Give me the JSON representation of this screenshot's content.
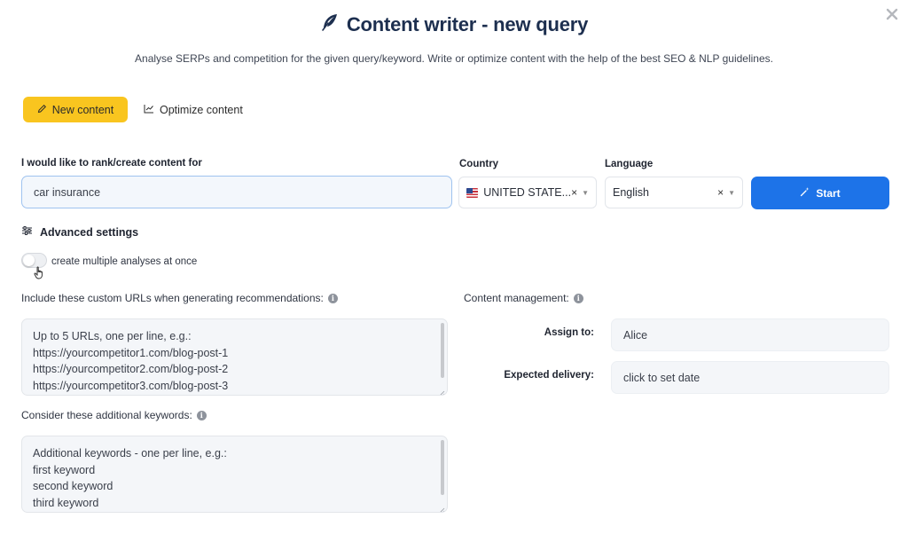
{
  "header": {
    "title": "Content writer - new query",
    "subtitle": "Analyse SERPs and competition for the given query/keyword. Write or optimize content with the help of the best SEO & NLP guidelines.",
    "title_icon": "feather-quill-icon",
    "close_icon": "close-icon"
  },
  "tabs": {
    "new_content": "New content",
    "optimize_content": "Optimize content",
    "active": "New content"
  },
  "query": {
    "label": "I would like to rank/create content for",
    "value": "car insurance"
  },
  "country": {
    "label": "Country",
    "value": "UNITED STATE...",
    "flag": "us-flag-icon"
  },
  "language": {
    "label": "Language",
    "value": "English"
  },
  "start_button": {
    "label": "Start",
    "color": "#1d73e8"
  },
  "advanced": {
    "label": "Advanced settings",
    "multiple_label": "create multiple analyses at once",
    "multiple_enabled": false
  },
  "custom_urls": {
    "label": "Include these custom URLs when generating recommendations:",
    "placeholder": "Up to 5 URLs, one per line, e.g.:\nhttps://yourcompetitor1.com/blog-post-1\nhttps://yourcompetitor2.com/blog-post-2\nhttps://yourcompetitor3.com/blog-post-3"
  },
  "additional_keywords": {
    "label": "Consider these additional keywords:",
    "placeholder": "Additional keywords - one per line, e.g.:\nfirst keyword\nsecond keyword\nthird keyword"
  },
  "content_management": {
    "label": "Content management:",
    "assign_label": "Assign to:",
    "assign_value": "Alice",
    "delivery_label": "Expected delivery:",
    "delivery_value": "click to set date"
  },
  "colors": {
    "accent_yellow": "#f9c51f",
    "primary_blue": "#1d73e8",
    "title_navy": "#1d2f4f"
  }
}
